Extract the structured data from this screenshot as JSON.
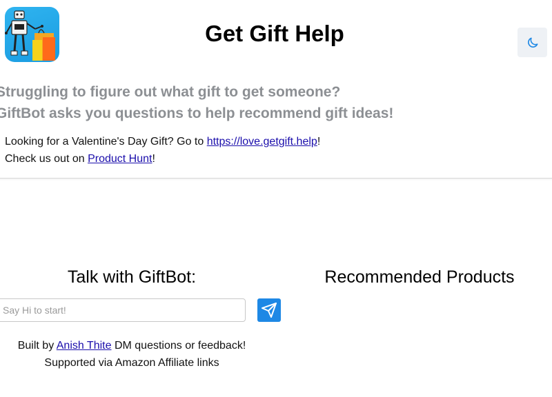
{
  "header": {
    "title": "Get Gift Help",
    "logo_icon": "giftbot-robot-logo-icon",
    "dark_mode_icon": "moon-icon"
  },
  "tagline": {
    "line1": "Struggling to figure out what gift to get someone?",
    "line2": "GiftBot asks you questions to help recommend gift ideas!"
  },
  "promo": {
    "valentine_prefix": "Looking for a Valentine's Day Gift? Go to ",
    "valentine_link": "https://love.getgift.help",
    "valentine_suffix": "!",
    "producthunt_prefix": "Check us out on ",
    "producthunt_link": "Product Hunt",
    "producthunt_suffix": "!"
  },
  "chat": {
    "heading": "Talk with GiftBot:",
    "input_placeholder": "Say Hi to start!",
    "input_value": "",
    "send_icon": "paper-plane-icon"
  },
  "footer": {
    "built_by_prefix": "Built by ",
    "author_link": "Anish Thite",
    "built_by_suffix": " DM questions or feedback!",
    "affiliate_note": "Supported via Amazon Affiliate links"
  },
  "products": {
    "heading": "Recommended Products"
  },
  "colors": {
    "accent": "#1e88e5",
    "link": "#1a0dab",
    "tagline": "#8c8f93",
    "logo_bg": "#1a9be0"
  }
}
